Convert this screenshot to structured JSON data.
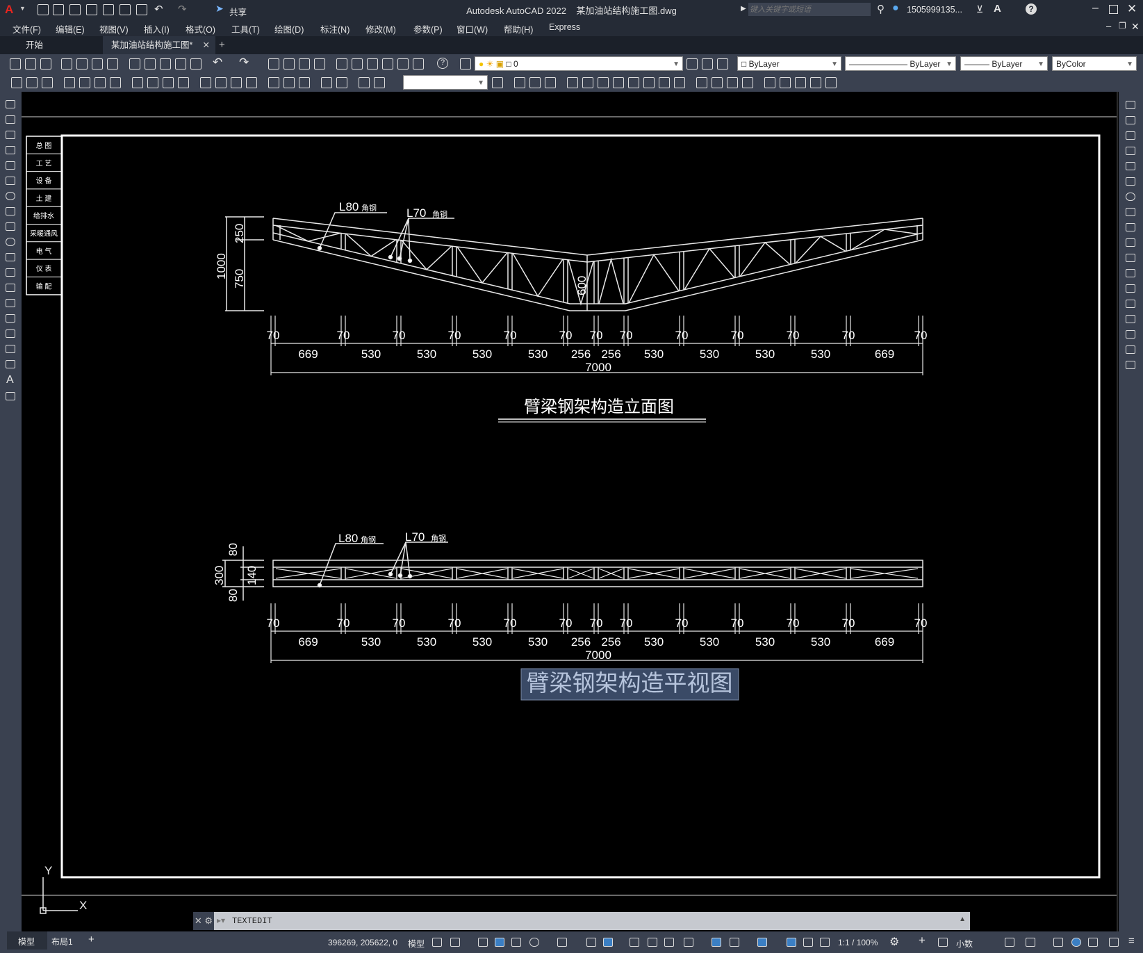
{
  "window": {
    "app_title": "Autodesk AutoCAD 2022",
    "file_title": "某加油站结构施工图.dwg",
    "quick_share": "共享",
    "search_placeholder": "键入关键字或短语",
    "user": "1505999135...",
    "window_controls": [
      "minimize-icon",
      "maximize-icon",
      "close-icon"
    ]
  },
  "menu": [
    "文件(F)",
    "编辑(E)",
    "视图(V)",
    "插入(I)",
    "格式(O)",
    "工具(T)",
    "绘图(D)",
    "标注(N)",
    "修改(M)",
    "参数(P)",
    "窗口(W)",
    "帮助(H)",
    "Express"
  ],
  "tabs": [
    {
      "label": "开始",
      "active": false
    },
    {
      "label": "某加油站结构施工图*",
      "active": true
    }
  ],
  "properties": {
    "layer": "0",
    "color": "ByLayer",
    "linetype": "ByLayer",
    "lineweight": "ByLayer",
    "plotstyle": "ByColor"
  },
  "sidebar_table": [
    "总 图",
    "工 艺",
    "设 备",
    "土 建",
    "给排水",
    "采暖通风",
    "电 气",
    "仪 表",
    "输 配"
  ],
  "drawing": {
    "elevation": {
      "title": "臂梁钢架构造立面图",
      "callout_l80": "L80",
      "callout_l70": "L70",
      "callout_suffix": "角钢",
      "dims_vertical": [
        "1000",
        "250",
        "750",
        "600"
      ],
      "bay_widths": [
        "669",
        "530",
        "530",
        "530",
        "530",
        "256",
        "256",
        "530",
        "530",
        "530",
        "530",
        "669"
      ],
      "member_width": "70",
      "total": "7000"
    },
    "plan": {
      "title": "臂梁钢架构造平视图",
      "callout_l80": "L80",
      "callout_l70": "L70",
      "callout_suffix": "角钢",
      "dims_vertical": [
        "300",
        "80",
        "140",
        "80"
      ],
      "bay_widths": [
        "669",
        "530",
        "530",
        "530",
        "530",
        "256",
        "256",
        "530",
        "530",
        "530",
        "530",
        "669"
      ],
      "member_width": "70",
      "total": "7000"
    },
    "ucs": {
      "x": "X",
      "y": "Y"
    }
  },
  "command_line": {
    "text": "TEXTEDIT"
  },
  "layout_tabs": [
    "模型",
    "布局1"
  ],
  "status": {
    "coords": "396269, 205622, 0",
    "model": "模型",
    "scale": "1:1 / 100%",
    "units": "小数"
  }
}
